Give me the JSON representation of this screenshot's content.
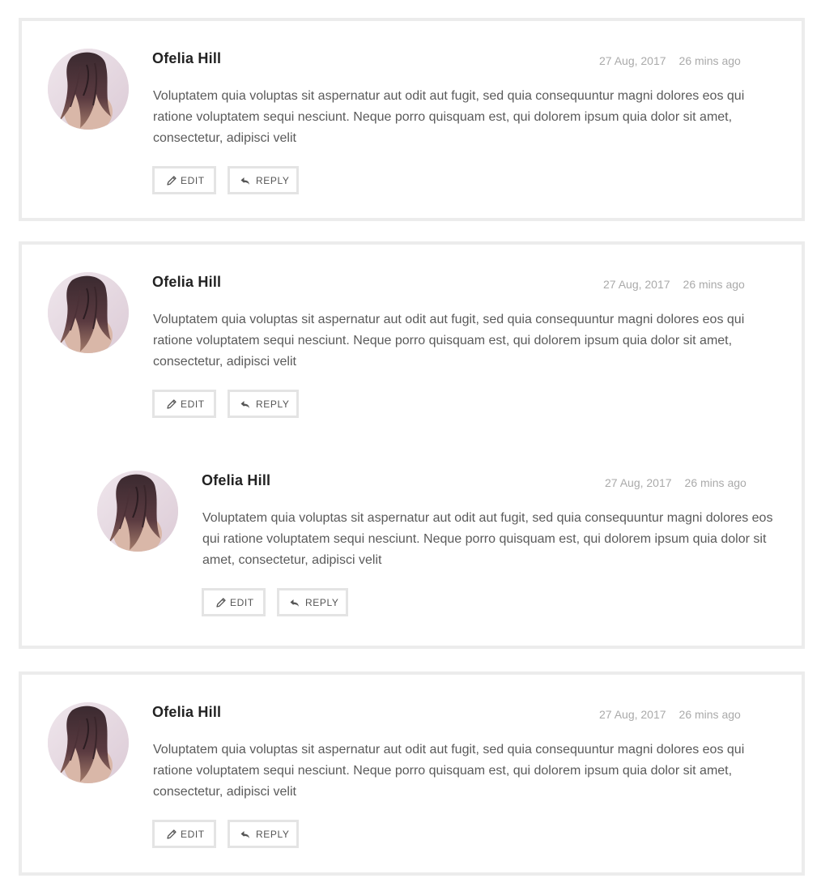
{
  "comments": [
    {
      "author": "Ofelia Hill",
      "date": "27 Aug, 2017",
      "ago": "26 mins ago",
      "text": "Voluptatem quia voluptas sit aspernatur aut odit aut fugit, sed quia consequuntur magni dolores eos qui ratione voluptatem sequi nesciunt. Neque porro quisquam est, qui dolorem ipsum quia dolor sit amet, consectetur, adipisci velit",
      "edit_label": "EDIT",
      "reply_label": "REPLY"
    },
    {
      "author": "Ofelia Hill",
      "date": "27 Aug, 2017",
      "ago": "26 mins ago",
      "text": "Voluptatem quia voluptas sit aspernatur aut odit aut fugit, sed quia consequuntur magni dolores eos qui ratione voluptatem sequi nesciunt. Neque porro quisquam est, qui dolorem ipsum quia dolor sit amet, consectetur, adipisci velit",
      "edit_label": "EDIT",
      "reply_label": "REPLY",
      "replies": [
        {
          "author": "Ofelia Hill",
          "date": "27 Aug, 2017",
          "ago": "26 mins ago",
          "text": "Voluptatem quia voluptas sit aspernatur aut odit aut fugit, sed quia consequuntur magni dolores eos qui ratione voluptatem sequi nesciunt. Neque porro quisquam est, qui dolorem ipsum quia dolor sit amet, consectetur, adipisci velit",
          "edit_label": "EDIT",
          "reply_label": "REPLY"
        }
      ]
    },
    {
      "author": "Ofelia Hill",
      "date": "27 Aug, 2017",
      "ago": "26 mins ago",
      "text": "Voluptatem quia voluptas sit aspernatur aut odit aut fugit, sed quia consequuntur magni dolores eos qui ratione voluptatem sequi nesciunt. Neque porro quisquam est, qui dolorem ipsum quia dolor sit amet, consectetur, adipisci velit",
      "edit_label": "EDIT",
      "reply_label": "REPLY"
    }
  ],
  "icons": {
    "edit": "pencil-icon",
    "reply": "reply-arrow-icon"
  },
  "colors": {
    "card_border": "#ececec",
    "button_border": "#e4e4e4",
    "author": "#222222",
    "meta": "#aaaaaa",
    "body": "#5a5a5a"
  }
}
